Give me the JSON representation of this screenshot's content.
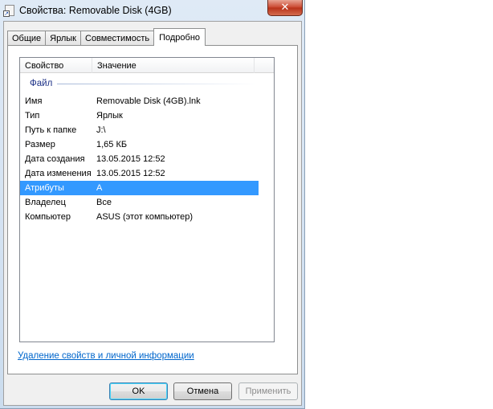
{
  "window": {
    "title": "Свойства: Removable Disk (4GB)",
    "close_label": "✕"
  },
  "tabs": [
    {
      "label": "Общие",
      "active": false
    },
    {
      "label": "Ярлык",
      "active": false
    },
    {
      "label": "Совместимость",
      "active": false
    },
    {
      "label": "Подробно",
      "active": true
    }
  ],
  "details": {
    "columns": [
      "Свойство",
      "Значение",
      ""
    ],
    "group": "Файл",
    "rows": [
      {
        "property": "Имя",
        "value": "Removable Disk (4GB).lnk"
      },
      {
        "property": "Тип",
        "value": "Ярлык"
      },
      {
        "property": "Путь к папке",
        "value": "J:\\"
      },
      {
        "property": "Размер",
        "value": "1,65 КБ"
      },
      {
        "property": "Дата создания",
        "value": "13.05.2015 12:52"
      },
      {
        "property": "Дата изменения",
        "value": "13.05.2015 12:52"
      },
      {
        "property": "Атрибуты",
        "value": "A",
        "selected": true
      },
      {
        "property": "Владелец",
        "value": "Все"
      },
      {
        "property": "Компьютер",
        "value": "ASUS (этот компьютер)"
      }
    ]
  },
  "link": "Удаление свойств и личной информации",
  "buttons": {
    "ok": "OK",
    "cancel": "Отмена",
    "apply": "Применить"
  },
  "colors": {
    "selection": "#3399ff",
    "link": "#0066cc",
    "group_text": "#1e3287"
  }
}
